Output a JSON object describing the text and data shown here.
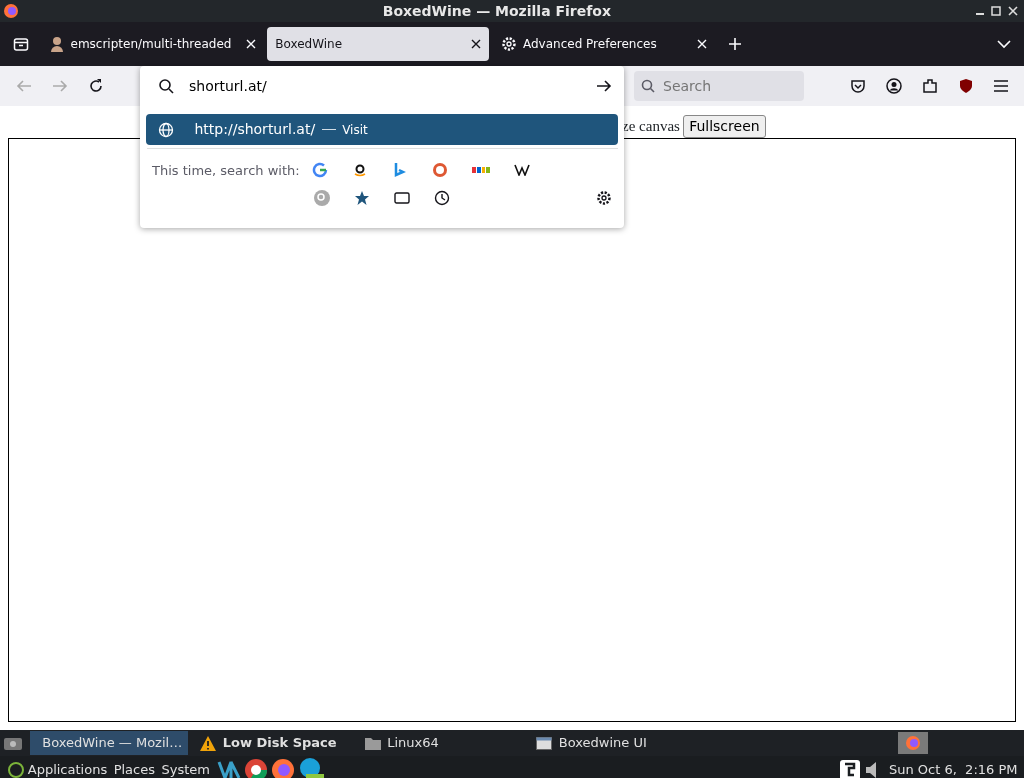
{
  "window": {
    "title": "BoxedWine — Mozilla Firefox"
  },
  "tabs": [
    {
      "label": "emscripten/multi-threaded",
      "selected": false,
      "kind": "avatar"
    },
    {
      "label": "BoxedWine",
      "selected": true,
      "kind": "plain"
    },
    {
      "label": "Advanced Preferences",
      "selected": false,
      "kind": "gear"
    }
  ],
  "urlbar": {
    "value": "shorturl.at/"
  },
  "search": {
    "placeholder": "Search"
  },
  "suggestions": [
    {
      "url": "http://shorturl.at/",
      "action": "Visit",
      "selected": true
    }
  ],
  "search_with": {
    "label": "This time, search with:"
  },
  "page": {
    "text": "ze canvas",
    "button": "Fullscreen"
  },
  "taskbar": {
    "windows": [
      {
        "label": "BoxedWine — Mozil…",
        "selected": true,
        "kind": "firefox"
      },
      {
        "label": "Low Disk Space",
        "selected": false,
        "kind": "warning"
      },
      {
        "label": "Linux64",
        "selected": false,
        "kind": "folder"
      },
      {
        "label": "Boxedwine UI",
        "selected": false,
        "kind": "window"
      }
    ],
    "menus": [
      "Applications",
      "Places",
      "System"
    ],
    "clock": "Sun Oct 6,  2:16 PM"
  }
}
